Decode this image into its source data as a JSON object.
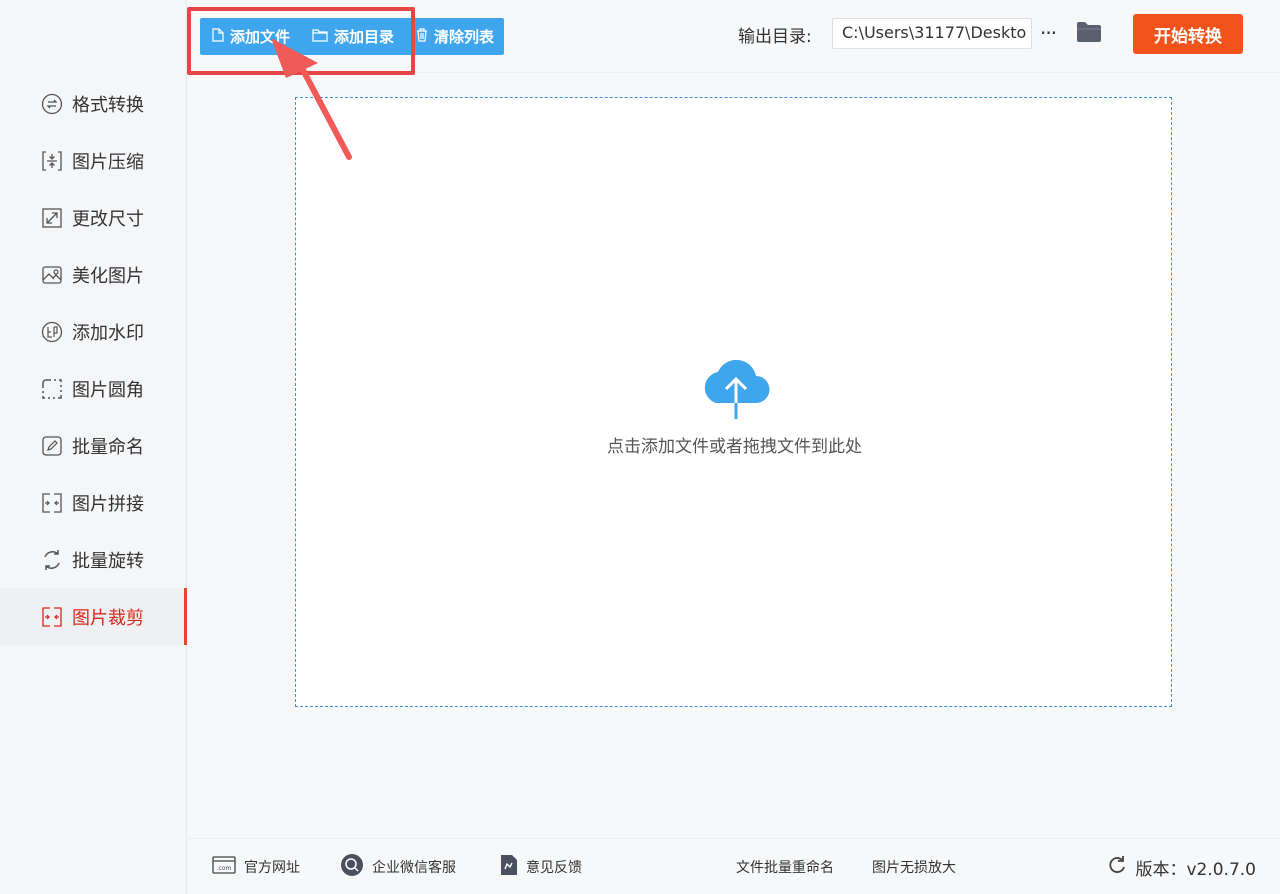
{
  "sidebar": {
    "items": [
      {
        "label": "格式转换",
        "icon": "format-convert-icon"
      },
      {
        "label": "图片压缩",
        "icon": "compress-icon"
      },
      {
        "label": "更改尺寸",
        "icon": "resize-icon"
      },
      {
        "label": "美化图片",
        "icon": "beautify-icon"
      },
      {
        "label": "添加水印",
        "icon": "watermark-icon"
      },
      {
        "label": "图片圆角",
        "icon": "rounded-corner-icon"
      },
      {
        "label": "批量命名",
        "icon": "rename-icon"
      },
      {
        "label": "图片拼接",
        "icon": "stitch-icon"
      },
      {
        "label": "批量旋转",
        "icon": "rotate-icon"
      },
      {
        "label": "图片裁剪",
        "icon": "crop-icon",
        "active": true
      }
    ]
  },
  "toolbar": {
    "add_file": "添加文件",
    "add_folder": "添加目录",
    "clear_list": "清除列表",
    "output_label": "输出目录:",
    "output_path": "C:\\Users\\31177\\Deskto",
    "more": "···",
    "start": "开始转换"
  },
  "main": {
    "drop_hint": "点击添加文件或者拖拽文件到此处"
  },
  "footer": {
    "website": "官方网址",
    "wechat_service": "企业微信客服",
    "feedback": "意见反馈",
    "batch_rename": "文件批量重命名",
    "lossless_enlarge": "图片无损放大",
    "version": "版本：v2.0.7.0"
  },
  "colors": {
    "accent_blue": "#3fa6ee",
    "start_orange": "#f2531a",
    "active_red": "#d9281b",
    "highlight_red": "#e84545"
  }
}
